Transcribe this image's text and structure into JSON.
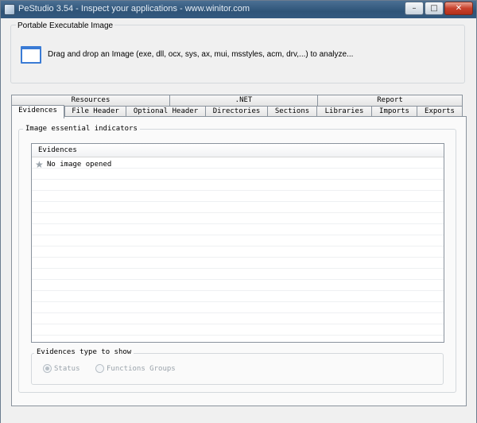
{
  "window": {
    "title": "PeStudio 3.54 - Inspect your applications - www.winitor.com",
    "minimize_label": "–",
    "maximize_label": "□",
    "close_label": "✕"
  },
  "drop_zone": {
    "group_title": "Portable Executable Image",
    "instruction": "Drag and drop an Image (exe, dll, ocx, sys, ax, mui, msstyles, acm, drv,...) to analyze..."
  },
  "tabs": {
    "row_top": [
      ".NET",
      "Resources",
      "Report"
    ],
    "row_bottom": [
      "Evidences",
      "File Header",
      "Optional Header",
      "Directories",
      "Sections",
      "Libraries",
      "Imports",
      "Exports"
    ],
    "active": "Evidences"
  },
  "evidences": {
    "group_title": "Image essential indicators",
    "column_header": "Evidences",
    "items": [
      "No image opened"
    ]
  },
  "type_filter": {
    "group_title": "Evidences type to show",
    "options": [
      {
        "label": "Status",
        "checked": true
      },
      {
        "label": "Functions Groups",
        "checked": false
      }
    ]
  }
}
